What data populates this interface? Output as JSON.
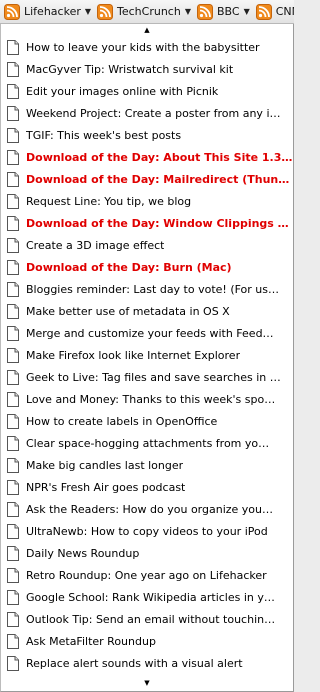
{
  "bookmarks_bar": {
    "feeds": [
      {
        "label": "Lifehacker",
        "icon": "rss-feed-icon"
      },
      {
        "label": "TechCrunch",
        "icon": "rss-feed-icon"
      },
      {
        "label": "BBC",
        "icon": "rss-feed-icon"
      },
      {
        "label": "CNN",
        "icon": "rss-feed-icon"
      }
    ],
    "caret": "▼"
  },
  "menu": {
    "scroll_up": "▲",
    "scroll_down": "▼",
    "items": [
      {
        "label": "How to leave your kids with the babysitter",
        "unread": false
      },
      {
        "label": "MacGyver Tip: Wristwatch survival kit",
        "unread": false
      },
      {
        "label": "Edit your images online with Picnik",
        "unread": false
      },
      {
        "label": "Weekend Project: Create a poster from any i…",
        "unread": false
      },
      {
        "label": "TGIF: This week's best posts",
        "unread": false
      },
      {
        "label": "Download of the Day: About This Site 1.3…",
        "unread": true
      },
      {
        "label": "Download of the Day: Mailredirect (Thun…",
        "unread": true
      },
      {
        "label": "Request Line: You tip, we blog",
        "unread": false
      },
      {
        "label": "Download of the Day: Window Clippings …",
        "unread": true
      },
      {
        "label": "Create a 3D image effect",
        "unread": false
      },
      {
        "label": "Download of the Day: Burn (Mac)",
        "unread": true
      },
      {
        "label": "Bloggies reminder: Last day to vote! (For us…",
        "unread": false
      },
      {
        "label": "Make better use of metadata in OS X",
        "unread": false
      },
      {
        "label": "Merge and customize your feeds with Feed…",
        "unread": false
      },
      {
        "label": "Make Firefox look like Internet Explorer",
        "unread": false
      },
      {
        "label": "Geek to Live: Tag files and save searches in …",
        "unread": false
      },
      {
        "label": "Love and Money: Thanks to this week's spo…",
        "unread": false
      },
      {
        "label": "How to create labels in OpenOffice",
        "unread": false
      },
      {
        "label": "Clear space-hogging attachments from yo…",
        "unread": false
      },
      {
        "label": "Make big candles last longer",
        "unread": false
      },
      {
        "label": "NPR's Fresh Air goes podcast",
        "unread": false
      },
      {
        "label": "Ask the Readers: How do you organize you…",
        "unread": false
      },
      {
        "label": "UltraNewb: How to copy videos to your iPod",
        "unread": false
      },
      {
        "label": "Daily News Roundup",
        "unread": false
      },
      {
        "label": "Retro Roundup: One year ago on Lifehacker",
        "unread": false
      },
      {
        "label": "Google School: Rank Wikipedia articles in y…",
        "unread": false
      },
      {
        "label": "Outlook Tip: Send an email without touchin…",
        "unread": false
      },
      {
        "label": "Ask MetaFilter Roundup",
        "unread": false
      },
      {
        "label": "Replace alert sounds with a visual alert",
        "unread": false
      }
    ]
  },
  "colors": {
    "feed_icon_orange": "#f08a1c",
    "unread_red": "#e00000"
  }
}
